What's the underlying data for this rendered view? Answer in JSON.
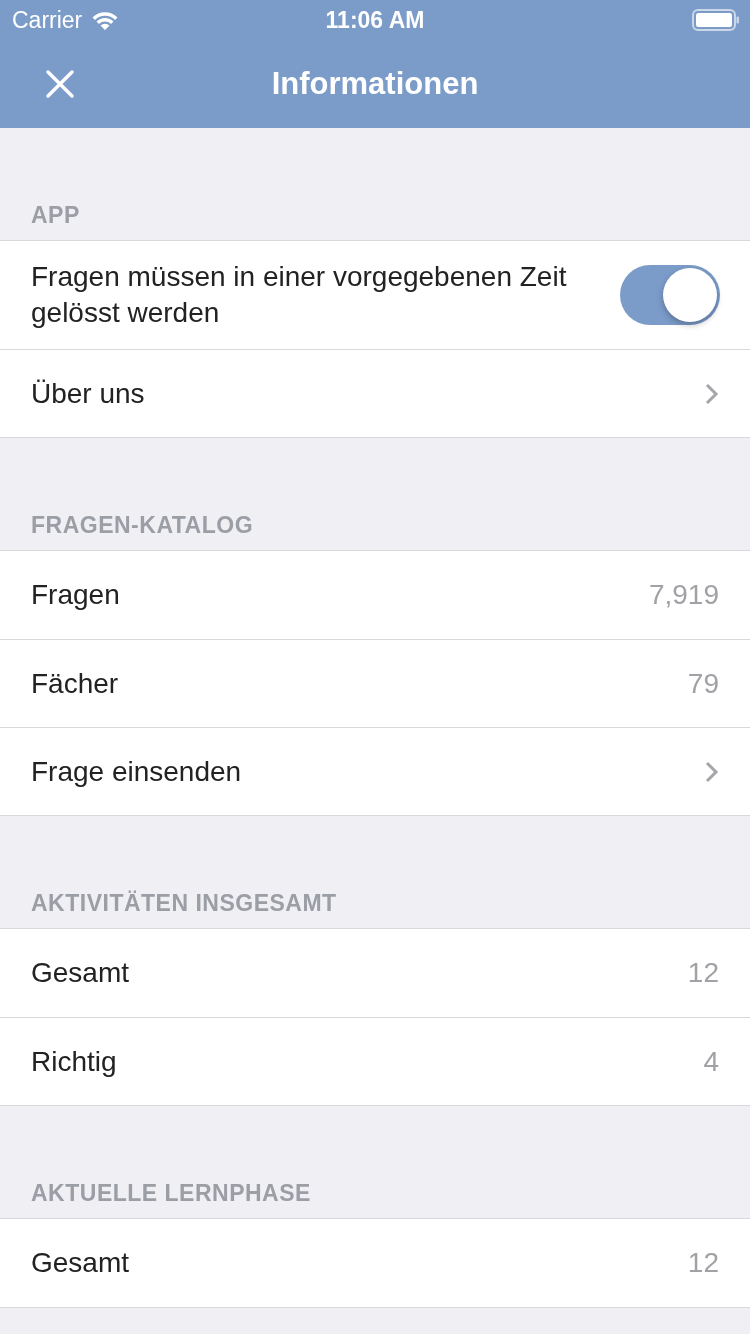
{
  "status_bar": {
    "carrier": "Carrier",
    "time": "11:06 AM"
  },
  "nav_bar": {
    "title": "Informationen"
  },
  "sections": [
    {
      "header": "APP",
      "rows": [
        {
          "kind": "toggle",
          "label": "Fragen müssen in einer vorgegebenen Zeit gelösst werden",
          "on": true
        },
        {
          "kind": "link",
          "label": "Über uns"
        }
      ]
    },
    {
      "header": "FRAGEN-KATALOG",
      "rows": [
        {
          "kind": "value",
          "label": "Fragen",
          "value": "7,919"
        },
        {
          "kind": "value",
          "label": "Fächer",
          "value": "79"
        },
        {
          "kind": "link",
          "label": "Frage einsenden"
        }
      ]
    },
    {
      "header": "AKTIVITÄTEN INSGESAMT",
      "rows": [
        {
          "kind": "value",
          "label": "Gesamt",
          "value": "12"
        },
        {
          "kind": "value",
          "label": "Richtig",
          "value": "4"
        }
      ]
    },
    {
      "header": "AKTUELLE LERNPHASE",
      "rows": [
        {
          "kind": "value",
          "label": "Gesamt",
          "value": "12"
        }
      ]
    }
  ]
}
